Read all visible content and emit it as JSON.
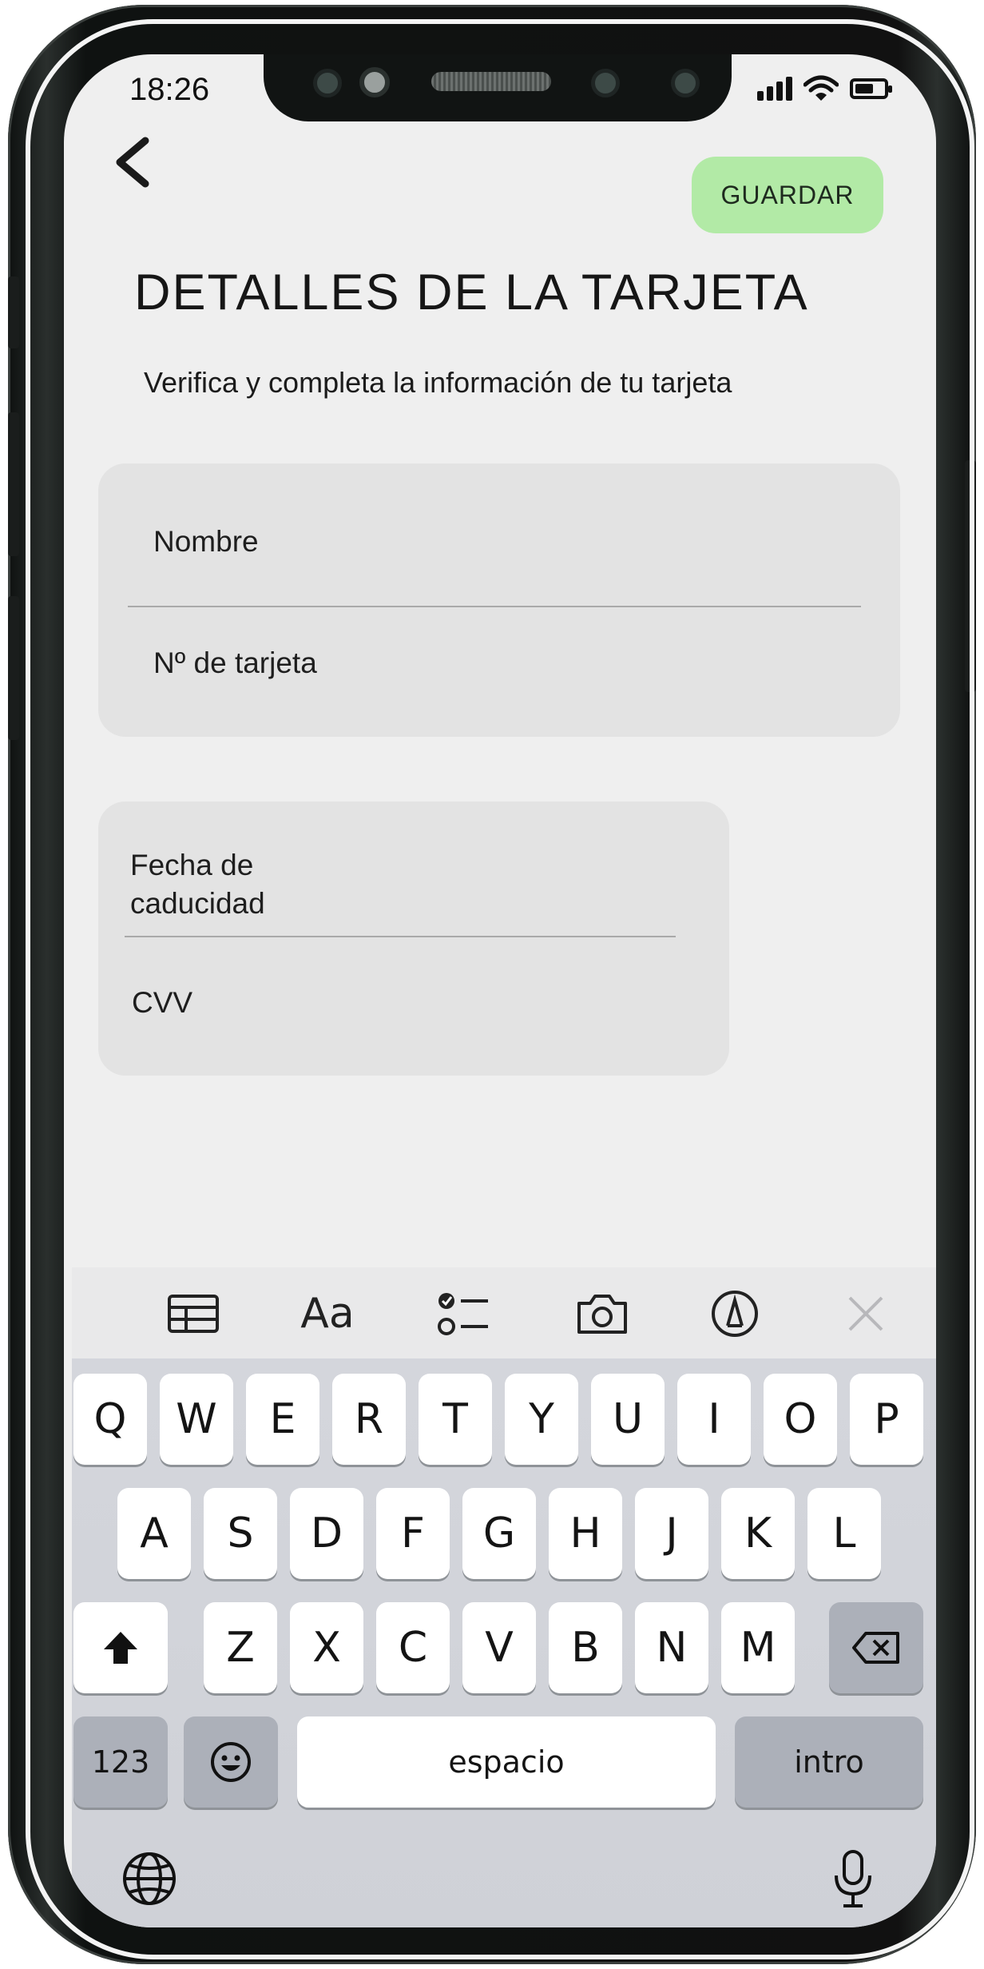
{
  "status": {
    "time": "18:26"
  },
  "header": {
    "save_label": "GUARDAR",
    "title": "DETALLES DE LA TARJETA",
    "subtitle": "Verifica y completa la información de tu tarjeta"
  },
  "card_fields": {
    "name": "Nombre",
    "card_number": "Nº de tarjeta",
    "expiry_line1": "Fecha de",
    "expiry_line2": "caducidad",
    "cvv": "CVV"
  },
  "toolbar": {
    "icons": [
      "table-icon",
      "text-format-icon",
      "checklist-icon",
      "camera-icon",
      "markup-icon",
      "close-icon"
    ],
    "text_format_label": "Aa"
  },
  "keyboard": {
    "row1": [
      "Q",
      "W",
      "E",
      "R",
      "T",
      "Y",
      "U",
      "I",
      "O",
      "P"
    ],
    "row2": [
      "A",
      "S",
      "D",
      "F",
      "G",
      "H",
      "J",
      "K",
      "L"
    ],
    "row3": [
      "Z",
      "X",
      "C",
      "V",
      "B",
      "N",
      "M"
    ],
    "numbers_label": "123",
    "space_label": "espacio",
    "return_label": "intro"
  },
  "colors": {
    "accent": "#b2eaa6",
    "screen_bg": "#efefef",
    "card_bg": "#e3e3e3",
    "keyboard_bg": "#d1d3d9"
  }
}
